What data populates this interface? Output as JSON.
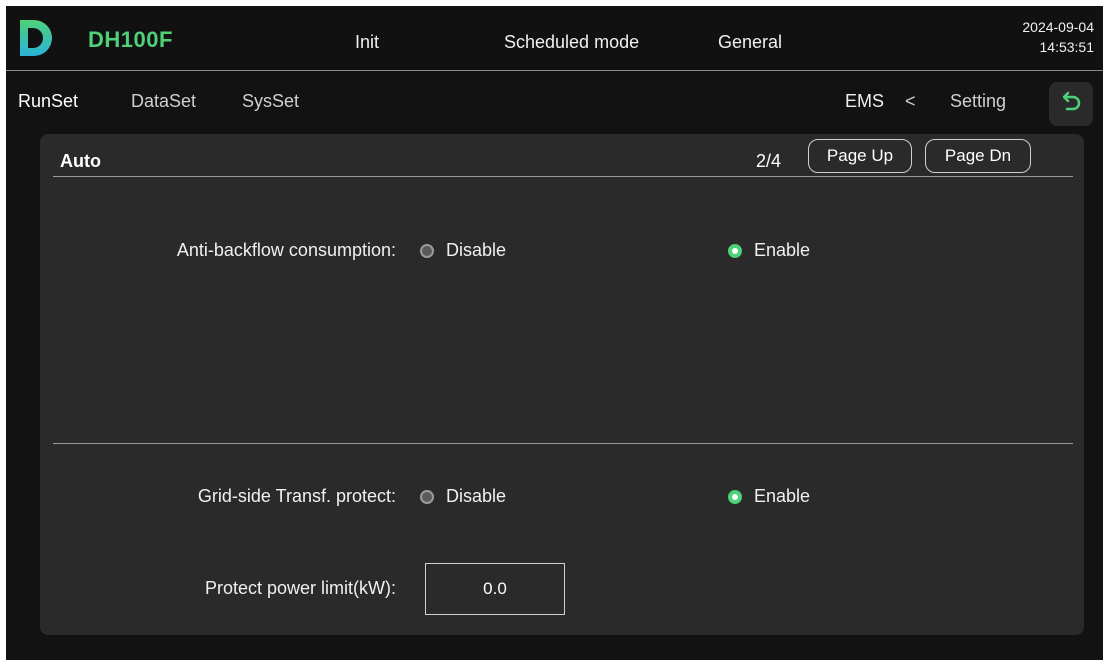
{
  "header": {
    "brand": "DH100F",
    "status": "Init",
    "mode": "Scheduled mode",
    "category": "General",
    "date": "2024-09-04",
    "time": "14:53:51",
    "brand_color": "#4fd17a",
    "logo_icon": "d-logo-icon"
  },
  "nav": {
    "tabs": [
      "RunSet",
      "DataSet",
      "SysSet"
    ],
    "breadcrumb": {
      "current": "EMS",
      "separator": "<",
      "parent": "Setting"
    },
    "back_icon": "return-arrow-icon"
  },
  "panel": {
    "title": "Auto",
    "page_indicator": "2/4",
    "page_up_label": "Page Up",
    "page_dn_label": "Page Dn",
    "rows": [
      {
        "label": "Anti-backflow consumption:",
        "options": [
          "Disable",
          "Enable"
        ],
        "selected": "Enable"
      },
      {
        "label": "Grid-side Transf. protect:",
        "options": [
          "Disable",
          "Enable"
        ],
        "selected": "Enable"
      },
      {
        "label": "Protect power limit(kW):",
        "value": "0.0"
      }
    ]
  }
}
